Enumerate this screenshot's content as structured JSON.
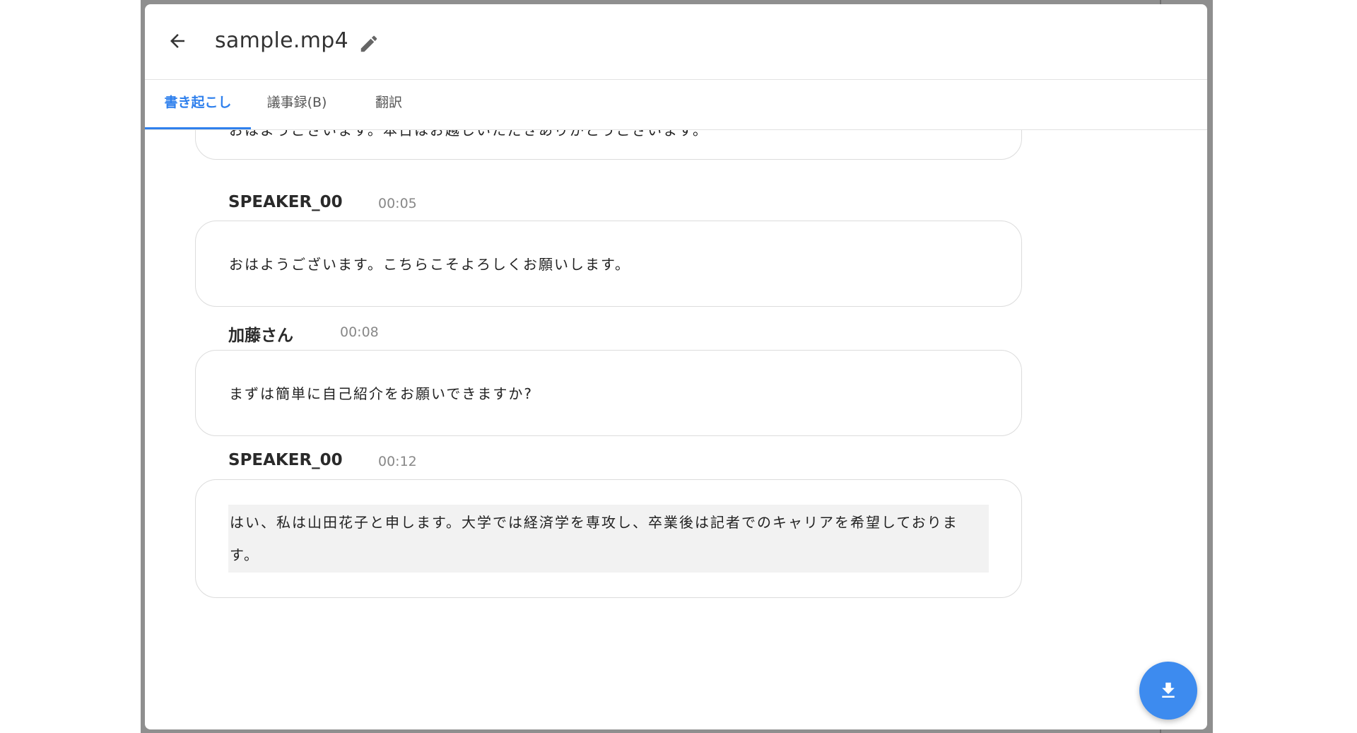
{
  "header": {
    "title": "sample.mp4",
    "back_icon": "arrow-back-icon",
    "edit_icon": "pencil-icon"
  },
  "tabs": [
    {
      "label": "書き起こし",
      "active": true
    },
    {
      "label": "議事録(B)",
      "active": false
    },
    {
      "label": "翻訳",
      "active": false
    }
  ],
  "transcript": [
    {
      "speaker": "",
      "time": "",
      "text": "おはようございます。本日はお越しいただきありがとうございます。"
    },
    {
      "speaker": "SPEAKER_00",
      "time": "00:05",
      "text": "おはようございます。こちらこそよろしくお願いします。"
    },
    {
      "speaker": "加藤さん",
      "time": "00:08",
      "text": "まずは簡単に自己紹介をお願いできますか?"
    },
    {
      "speaker": "SPEAKER_00",
      "time": "00:12",
      "text": "はい、私は山田花子と申します。大学では経済学を専攻し、卒業後は記者でのキャリアを希望しております。"
    }
  ],
  "fab": {
    "icon": "download-icon"
  },
  "colors": {
    "accent": "#2f80ed",
    "fab": "#3d8bef",
    "highlight": "#f2f2f2"
  }
}
